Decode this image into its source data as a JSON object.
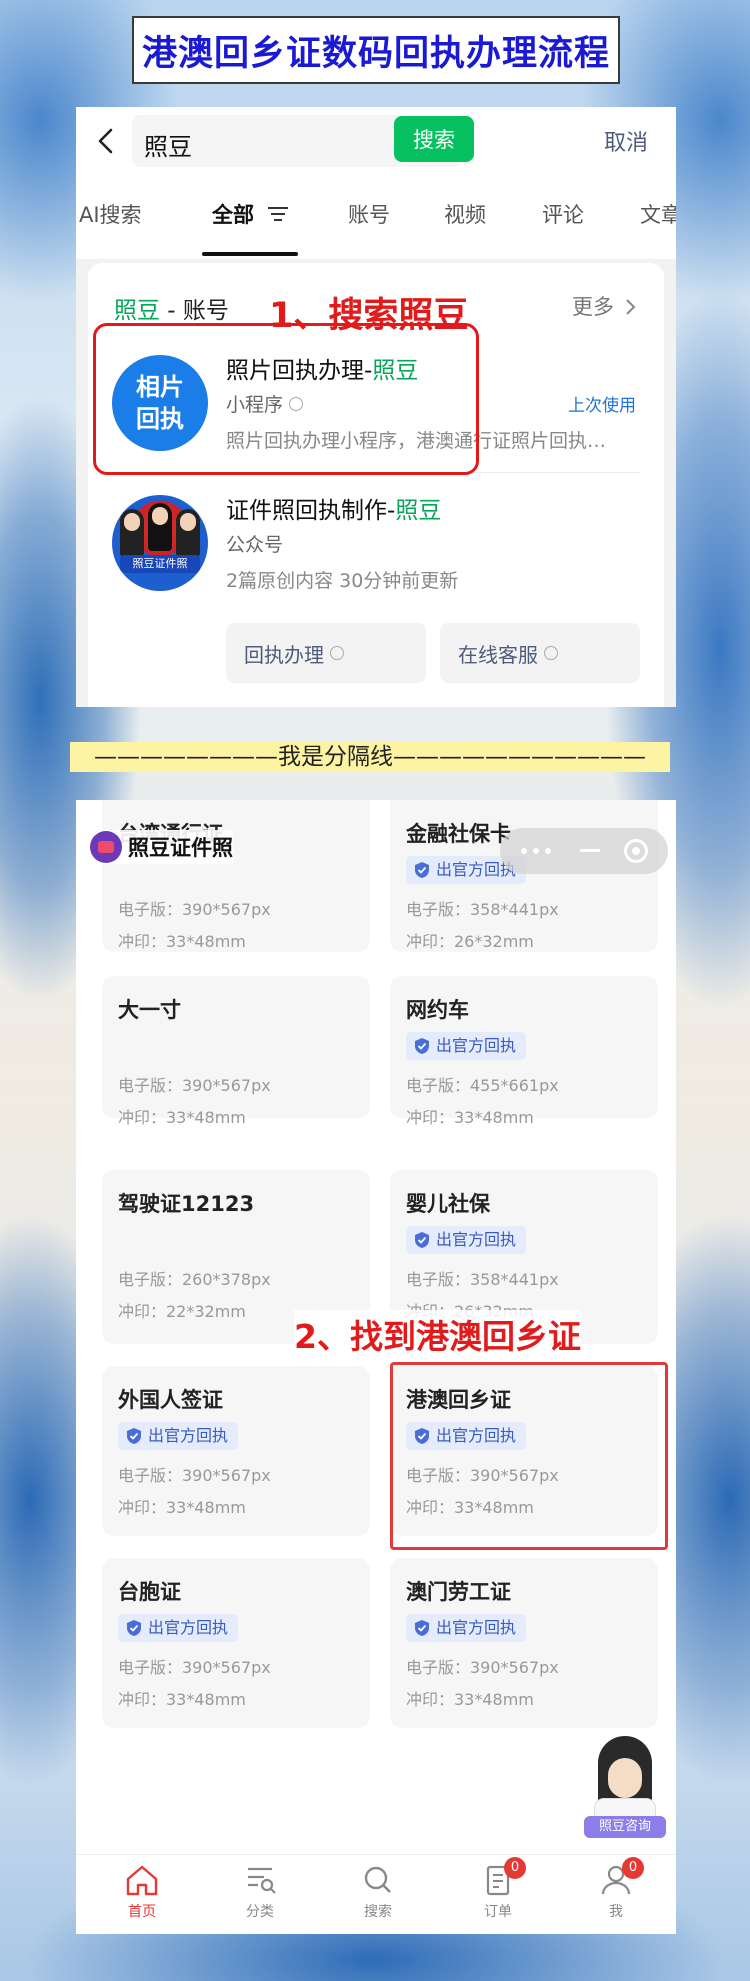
{
  "title": "港澳回乡证数码回执办理流程",
  "screen1": {
    "search": {
      "query": "照豆",
      "button_label": "搜索",
      "cancel_label": "取消"
    },
    "tabs": [
      "AI搜索",
      "全部",
      "账号",
      "视频",
      "评论",
      "文章"
    ],
    "active_tab": "全部",
    "card": {
      "head_brand": "照豆",
      "head_suffix": " - 账号",
      "more_label": "更多",
      "step1_label": "1、搜索照豆",
      "items": [
        {
          "logo_text_1": "相片",
          "logo_text_2": "回执",
          "title_prefix": "照片回执办理-",
          "title_highlight": "照豆",
          "type": "小程序",
          "desc": "照片回执办理小程序，港澳通行证照片回执…",
          "tag": "上次使用"
        },
        {
          "logo_badge": "照豆证件照",
          "title_prefix": "证件照回执制作-",
          "title_highlight": "照豆",
          "type": "公众号",
          "desc": "2篇原创内容  30分钟前更新",
          "buttons": [
            "回执办理",
            "在线客服"
          ]
        }
      ]
    }
  },
  "separator_text": "————————我是分隔线———————————",
  "screen2": {
    "brand_name": "照豆证件照",
    "step2_label": "2、找到港澳回乡证",
    "cards": [
      {
        "title": "台湾通行证",
        "badge": "",
        "line1": "电子版：390*567px",
        "line2": "冲印：33*48mm"
      },
      {
        "title": "金融社保卡",
        "badge": "出官方回执",
        "line1": "电子版：358*441px",
        "line2": "冲印：26*32mm"
      },
      {
        "title": "大一寸",
        "badge": "",
        "line1": "电子版：390*567px",
        "line2": "冲印：33*48mm"
      },
      {
        "title": "网约车",
        "badge": "出官方回执",
        "line1": "电子版：455*661px",
        "line2": "冲印：33*48mm"
      },
      {
        "title": "驾驶证12123",
        "badge": "",
        "line1": "电子版：260*378px",
        "line2": "冲印：22*32mm"
      },
      {
        "title": "婴儿社保",
        "badge": "出官方回执",
        "line1": "电子版：358*441px",
        "line2": "冲印：26*32mm"
      },
      {
        "title": "外国人签证",
        "badge": "出官方回执",
        "line1": "电子版：390*567px",
        "line2": "冲印：33*48mm"
      },
      {
        "title": "港澳回乡证",
        "badge": "出官方回执",
        "line1": "电子版：390*567px",
        "line2": "冲印：33*48mm"
      },
      {
        "title": "台胞证",
        "badge": "出官方回执",
        "line1": "电子版：390*567px",
        "line2": "冲印：33*48mm"
      },
      {
        "title": "澳门劳工证",
        "badge": "出官方回执",
        "line1": "电子版：390*567px",
        "line2": "冲印：33*48mm"
      }
    ],
    "consult_label": "照豆咨询",
    "nav": [
      {
        "label": "首页",
        "icon": "home-icon",
        "badge": ""
      },
      {
        "label": "分类",
        "icon": "category-icon",
        "badge": ""
      },
      {
        "label": "搜索",
        "icon": "search-icon",
        "badge": ""
      },
      {
        "label": "订单",
        "icon": "order-icon",
        "badge": "0"
      },
      {
        "label": "我",
        "icon": "profile-icon",
        "badge": "0"
      }
    ]
  },
  "colors": {
    "wechat_green": "#07c160",
    "annotation_red": "#e11b1b",
    "title_blue": "#1a1ad2",
    "badge_blue": "#3c5bbf"
  }
}
